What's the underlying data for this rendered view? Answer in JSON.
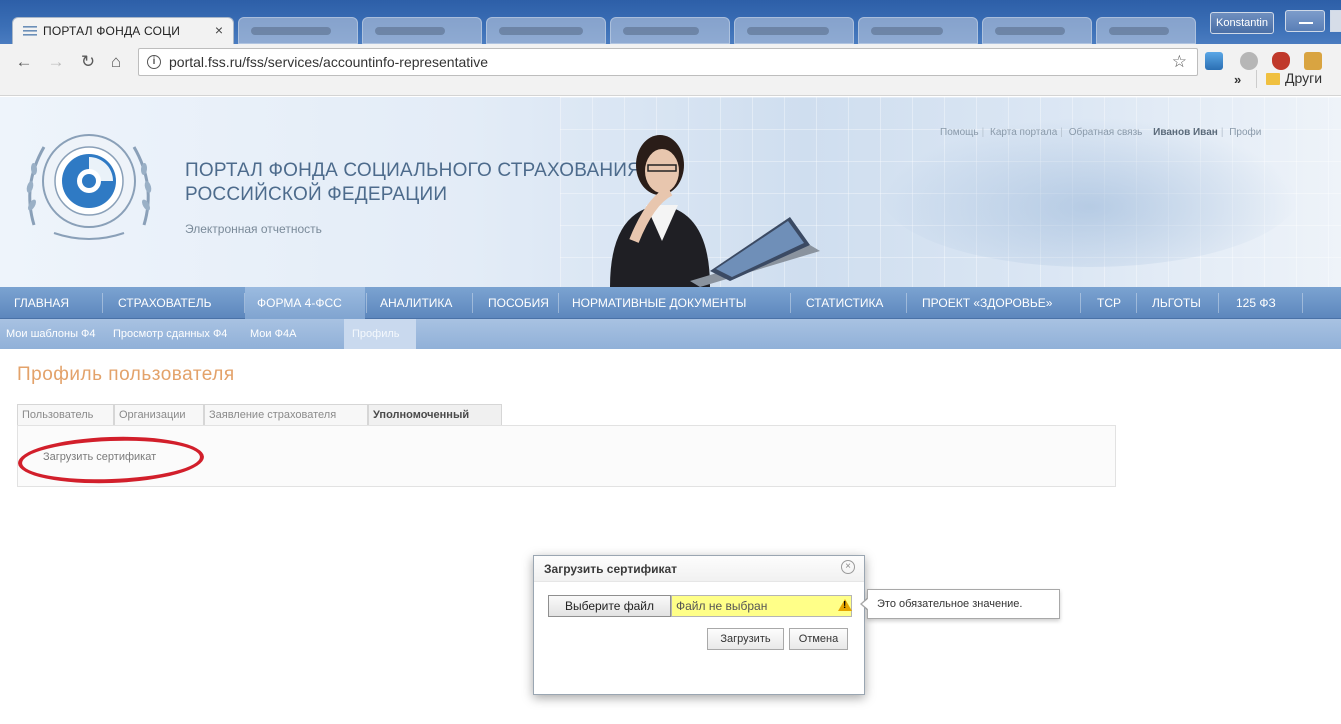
{
  "browser": {
    "active_tab_title": "ПОРТАЛ ФОНДА СОЦИ",
    "tab_close": "×",
    "profile_name": "Konstantin",
    "url": "portal.fss.ru/fss/services/accountinfo-representative",
    "bookmarks_more": "»",
    "bookmark_folder_label": "Други"
  },
  "portal": {
    "title_line1": "ПОРТАЛ ФОНДА СОЦИАЛЬНОГО СТРАХОВАНИЯ",
    "title_line2": "РОССИЙСКОЙ ФЕДЕРАЦИИ",
    "subtitle": "Электронная отчетность",
    "top_links": {
      "help": "Помощь",
      "sitemap": "Карта портала",
      "feedback": "Обратная связь",
      "user": "Иванов Иван",
      "profile": "Профи"
    }
  },
  "main_nav": [
    "ГЛАВНАЯ",
    "СТРАХОВАТЕЛЬ",
    "ФОРМА 4-ФСС",
    "АНАЛИТИКА",
    "ПОСОБИЯ",
    "НОРМАТИВНЫЕ ДОКУМЕНТЫ",
    "СТАТИСТИКА",
    "ПРОЕКТ «ЗДОРОВЬЕ»",
    "ТСР",
    "ЛЬГОТЫ",
    "125 ФЗ"
  ],
  "sub_nav": [
    "Мои шаблоны Ф4",
    "Просмотр сданных Ф4",
    "Мои Ф4А",
    "Профиль"
  ],
  "page": {
    "title": "Профиль пользователя",
    "tabs": [
      "Пользователь",
      "Организации",
      "Заявление страхователя",
      "Уполномоченный"
    ],
    "upload_link": "Загрузить сертификат"
  },
  "dialog": {
    "title": "Загрузить сертификат",
    "choose_file_label": "Выберите файл",
    "file_value": "Файл не выбран",
    "upload_button": "Загрузить",
    "cancel_button": "Отмена",
    "warn_mark": "!",
    "close_glyph": "×"
  },
  "tooltip": {
    "text": "Это обязательное значение."
  },
  "colors": {
    "nav_blue": "#6a92c6",
    "page_title": "#e3a26a",
    "highlight": "#d21f2b",
    "file_field_bg": "#ffff88"
  }
}
